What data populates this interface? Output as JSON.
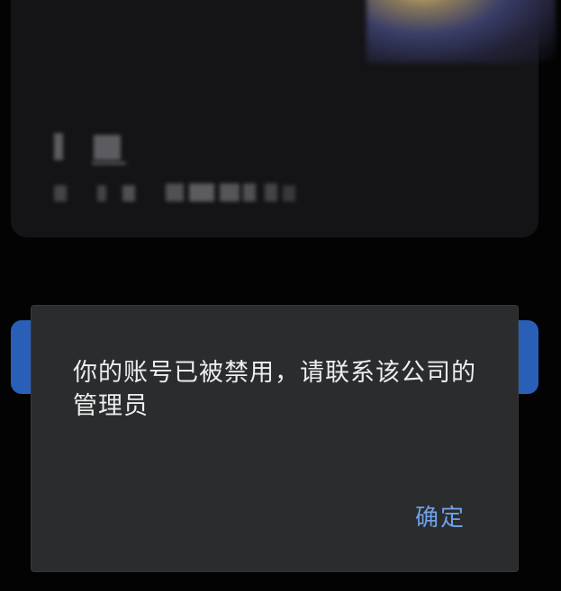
{
  "background_card": {
    "title": "",
    "image": "blurred-avatar-image"
  },
  "dialog": {
    "message": "你的账号已被禁用，请联系该公司的管理员",
    "confirm_label": "确定"
  },
  "colors": {
    "page_background": "#030303",
    "card_background": "#141416",
    "dialog_background": "#2a2c2e",
    "accent": "#6fa0e8",
    "button_blue": "#2a5fb8"
  }
}
